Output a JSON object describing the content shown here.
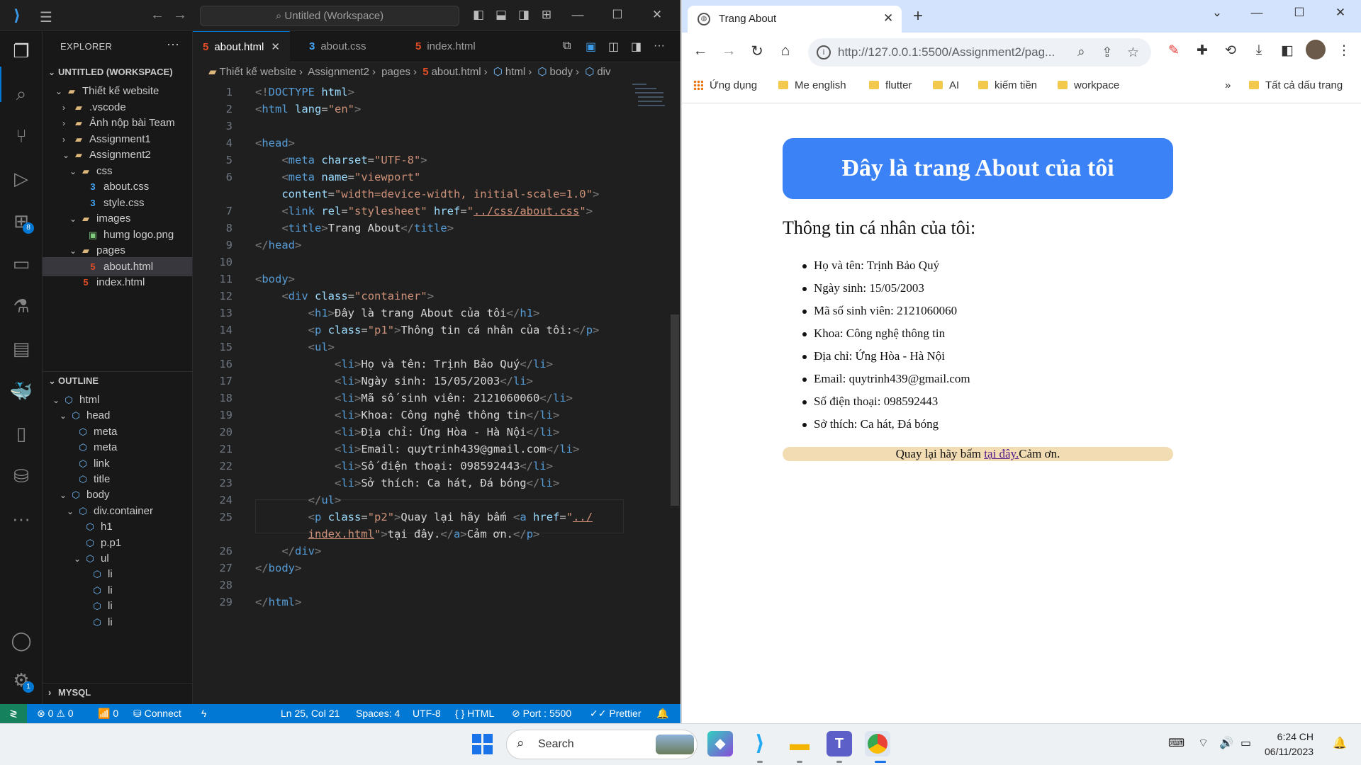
{
  "vscode": {
    "search_text": "Untitled (Workspace)",
    "explorer_title": "EXPLORER",
    "workspace_section": "UNTITLED (WORKSPACE)",
    "tree": [
      {
        "label": "Thiết kế website",
        "kind": "folder-open",
        "indent": 1
      },
      {
        "label": ".vscode",
        "kind": "folder",
        "indent": 2
      },
      {
        "label": "Ảnh nộp bài Team",
        "kind": "folder",
        "indent": 2
      },
      {
        "label": "Assignment1",
        "kind": "folder",
        "indent": 2
      },
      {
        "label": "Assignment2",
        "kind": "folder-open",
        "indent": 2
      },
      {
        "label": "css",
        "kind": "folder-open",
        "indent": 3
      },
      {
        "label": "about.css",
        "kind": "css",
        "indent": 4
      },
      {
        "label": "style.css",
        "kind": "css",
        "indent": 4
      },
      {
        "label": "images",
        "kind": "folder-open",
        "indent": 3
      },
      {
        "label": "humg logo.png",
        "kind": "image",
        "indent": 4
      },
      {
        "label": "pages",
        "kind": "folder-open",
        "indent": 3
      },
      {
        "label": "about.html",
        "kind": "html",
        "indent": 4,
        "selected": true
      },
      {
        "label": "index.html",
        "kind": "html",
        "indent": 3
      }
    ],
    "outline_section": "OUTLINE",
    "outline": [
      {
        "label": "html",
        "indent": 1
      },
      {
        "label": "head",
        "indent": 2
      },
      {
        "label": "meta",
        "indent": 3
      },
      {
        "label": "meta",
        "indent": 3
      },
      {
        "label": "link",
        "indent": 3
      },
      {
        "label": "title",
        "indent": 3
      },
      {
        "label": "body",
        "indent": 2
      },
      {
        "label": "div.container",
        "indent": 3
      },
      {
        "label": "h1",
        "indent": 4
      },
      {
        "label": "p.p1",
        "indent": 4
      },
      {
        "label": "ul",
        "indent": 4
      },
      {
        "label": "li",
        "indent": 5
      },
      {
        "label": "li",
        "indent": 5
      },
      {
        "label": "li",
        "indent": 5
      },
      {
        "label": "li",
        "indent": 5
      }
    ],
    "mysql_section": "MYSQL",
    "tabs": [
      {
        "label": "about.html",
        "icon": "html",
        "active": true
      },
      {
        "label": "about.css",
        "icon": "css",
        "active": false
      },
      {
        "label": "index.html",
        "icon": "html",
        "active": false
      }
    ],
    "breadcrumb": [
      "Thiết kế website",
      "Assignment2",
      "pages",
      "about.html",
      "html",
      "body",
      "div"
    ],
    "code_lines": [
      {
        "n": "1",
        "html": "<span class='t-br'>&lt;!</span><span class='t-tag'>DOCTYPE</span> <span class='t-attr'>html</span><span class='t-br'>&gt;</span>"
      },
      {
        "n": "2",
        "html": "<span class='t-br'>&lt;</span><span class='t-tag'>html</span> <span class='t-attr'>lang</span>=<span class='t-str'>\"en\"</span><span class='t-br'>&gt;</span>"
      },
      {
        "n": "3",
        "html": ""
      },
      {
        "n": "4",
        "html": "<span class='t-br'>&lt;</span><span class='t-tag'>head</span><span class='t-br'>&gt;</span>"
      },
      {
        "n": "5",
        "html": "    <span class='t-br'>&lt;</span><span class='t-tag'>meta</span> <span class='t-attr'>charset</span>=<span class='t-str'>\"UTF-8\"</span><span class='t-br'>&gt;</span>"
      },
      {
        "n": "6",
        "html": "    <span class='t-br'>&lt;</span><span class='t-tag'>meta</span> <span class='t-attr'>name</span>=<span class='t-str'>\"viewport\"</span>"
      },
      {
        "n": "",
        "html": "    <span class='t-attr'>content</span>=<span class='t-str'>\"width=device-width, initial-scale=1.0\"</span><span class='t-br'>&gt;</span>"
      },
      {
        "n": "7",
        "html": "    <span class='t-br'>&lt;</span><span class='t-tag'>link</span> <span class='t-attr'>rel</span>=<span class='t-str'>\"stylesheet\"</span> <span class='t-attr'>href</span>=<span class='t-str'>\"</span><span class='t-lnk'>../css/about.css</span><span class='t-str'>\"</span><span class='t-br'>&gt;</span>"
      },
      {
        "n": "8",
        "html": "    <span class='t-br'>&lt;</span><span class='t-tag'>title</span><span class='t-br'>&gt;</span><span class='t-txt'>Trang About</span><span class='t-br'>&lt;/</span><span class='t-tag'>title</span><span class='t-br'>&gt;</span>"
      },
      {
        "n": "9",
        "html": "<span class='t-br'>&lt;/</span><span class='t-tag'>head</span><span class='t-br'>&gt;</span>"
      },
      {
        "n": "10",
        "html": ""
      },
      {
        "n": "11",
        "html": "<span class='t-br'>&lt;</span><span class='t-tag'>body</span><span class='t-br'>&gt;</span>"
      },
      {
        "n": "12",
        "html": "    <span class='t-br'>&lt;</span><span class='t-tag'>div</span> <span class='t-attr'>class</span>=<span class='t-str'>\"container\"</span><span class='t-br'>&gt;</span>"
      },
      {
        "n": "13",
        "html": "        <span class='t-br'>&lt;</span><span class='t-tag'>h1</span><span class='t-br'>&gt;</span><span class='t-txt'>Đây là trang About của tôi</span><span class='t-br'>&lt;/</span><span class='t-tag'>h1</span><span class='t-br'>&gt;</span>"
      },
      {
        "n": "14",
        "html": "        <span class='t-br'>&lt;</span><span class='t-tag'>p</span> <span class='t-attr'>class</span>=<span class='t-str'>\"p1\"</span><span class='t-br'>&gt;</span><span class='t-txt'>Thông tin cá nhân của tôi:</span><span class='t-br'>&lt;/</span><span class='t-tag'>p</span><span class='t-br'>&gt;</span>"
      },
      {
        "n": "15",
        "html": "        <span class='t-br'>&lt;</span><span class='t-tag'>ul</span><span class='t-br'>&gt;</span>"
      },
      {
        "n": "16",
        "html": "            <span class='t-br'>&lt;</span><span class='t-tag'>li</span><span class='t-br'>&gt;</span><span class='t-txt'>Họ và tên: Trịnh Bảo Quý</span><span class='t-br'>&lt;/</span><span class='t-tag'>li</span><span class='t-br'>&gt;</span>"
      },
      {
        "n": "17",
        "html": "            <span class='t-br'>&lt;</span><span class='t-tag'>li</span><span class='t-br'>&gt;</span><span class='t-txt'>Ngày sinh: 15/05/2003</span><span class='t-br'>&lt;/</span><span class='t-tag'>li</span><span class='t-br'>&gt;</span>"
      },
      {
        "n": "18",
        "html": "            <span class='t-br'>&lt;</span><span class='t-tag'>li</span><span class='t-br'>&gt;</span><span class='t-txt'>Mã số sinh viên: 2121060060</span><span class='t-br'>&lt;/</span><span class='t-tag'>li</span><span class='t-br'>&gt;</span>"
      },
      {
        "n": "19",
        "html": "            <span class='t-br'>&lt;</span><span class='t-tag'>li</span><span class='t-br'>&gt;</span><span class='t-txt'>Khoa: Công nghệ thông tin</span><span class='t-br'>&lt;/</span><span class='t-tag'>li</span><span class='t-br'>&gt;</span>"
      },
      {
        "n": "20",
        "html": "            <span class='t-br'>&lt;</span><span class='t-tag'>li</span><span class='t-br'>&gt;</span><span class='t-txt'>Địa chỉ: Ứng Hòa - Hà Nội</span><span class='t-br'>&lt;/</span><span class='t-tag'>li</span><span class='t-br'>&gt;</span>"
      },
      {
        "n": "21",
        "html": "            <span class='t-br'>&lt;</span><span class='t-tag'>li</span><span class='t-br'>&gt;</span><span class='t-txt'>Email: quytrinh439@gmail.com</span><span class='t-br'>&lt;/</span><span class='t-tag'>li</span><span class='t-br'>&gt;</span>"
      },
      {
        "n": "22",
        "html": "            <span class='t-br'>&lt;</span><span class='t-tag'>li</span><span class='t-br'>&gt;</span><span class='t-txt'>Số điện thoại: 098592443</span><span class='t-br'>&lt;/</span><span class='t-tag'>li</span><span class='t-br'>&gt;</span>"
      },
      {
        "n": "23",
        "html": "            <span class='t-br'>&lt;</span><span class='t-tag'>li</span><span class='t-br'>&gt;</span><span class='t-txt'>Sở thích: Ca hát, Đá bóng</span><span class='t-br'>&lt;/</span><span class='t-tag'>li</span><span class='t-br'>&gt;</span>"
      },
      {
        "n": "24",
        "html": "        <span class='t-br'>&lt;/</span><span class='t-tag'>ul</span><span class='t-br'>&gt;</span>"
      },
      {
        "n": "25",
        "html": "        <span class='t-br'>&lt;</span><span class='t-tag'>p</span> <span class='t-attr'>class</span>=<span class='t-str'>\"p2\"</span><span class='t-br'>&gt;</span><span class='t-txt'>Quay lại hãy bấm </span><span class='t-br'>&lt;</span><span class='t-tag'>a</span> <span class='t-attr'>href</span>=<span class='t-str'>\"</span><span class='t-lnk'>../</span>"
      },
      {
        "n": "",
        "html": "        <span class='t-lnk'>index.html</span><span class='t-str'>\"</span><span class='t-br'>&gt;</span><span class='t-txt'>tại đây.</span><span class='t-br'>&lt;/</span><span class='t-tag'>a</span><span class='t-br'>&gt;</span><span class='t-txt'>Cảm ơn.</span><span class='t-br'>&lt;/</span><span class='t-tag'>p</span><span class='t-br'>&gt;</span>"
      },
      {
        "n": "26",
        "html": "    <span class='t-br'>&lt;/</span><span class='t-tag'>div</span><span class='t-br'>&gt;</span>"
      },
      {
        "n": "27",
        "html": "<span class='t-br'>&lt;/</span><span class='t-tag'>body</span><span class='t-br'>&gt;</span>"
      },
      {
        "n": "28",
        "html": ""
      },
      {
        "n": "29",
        "html": "<span class='t-br'>&lt;/</span><span class='t-tag'>html</span><span class='t-br'>&gt;</span>"
      }
    ],
    "status": {
      "errors": "⊗ 0 ⚠ 0",
      "ports": "📶 0",
      "connect": "Connect",
      "position": "Ln 25, Col 21",
      "spaces": "Spaces: 4",
      "encoding": "UTF-8",
      "language": "{ } HTML",
      "port": "⊘ Port : 5500",
      "prettier": "✓✓ Prettier"
    },
    "activity_badges": {
      "extensions": "8",
      "settings": "1"
    }
  },
  "chrome": {
    "tab_title": "Trang About",
    "url": "http://127.0.0.1:5500/Assignment2/pag...",
    "bookmarks": [
      "Ứng dụng",
      "Me english",
      "flutter",
      "AI",
      "kiếm tiền",
      "workpace"
    ],
    "all_bookmarks": "Tất cả dấu trang",
    "page": {
      "h1": "Đây là trang About của tôi",
      "p1": "Thông tin cá nhân của tôi:",
      "items": [
        "Họ và tên: Trịnh Bảo Quý",
        "Ngày sinh: 15/05/2003",
        "Mã số sinh viên: 2121060060",
        "Khoa: Công nghệ thông tin",
        "Địa chỉ: Ứng Hòa - Hà Nội",
        "Email: quytrinh439@gmail.com",
        "Số điện thoại: 098592443",
        "Sở thích: Ca hát, Đá bóng"
      ],
      "p2_before": "Quay lại hãy bấm ",
      "p2_link": "tại đây.",
      "p2_after": "Cảm ơn."
    }
  },
  "taskbar": {
    "search": "Search",
    "time": "6:24 CH",
    "date": "06/11/2023"
  },
  "colors": {
    "vscode_status": "#0078d4",
    "h1_bg": "#3b82f6",
    "p2_bg": "#f2dcb3"
  }
}
